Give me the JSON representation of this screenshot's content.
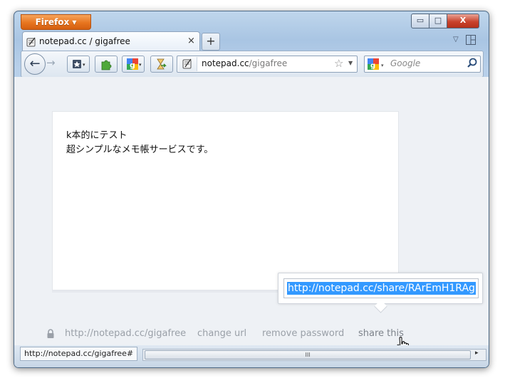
{
  "window": {
    "menu_button": "Firefox ▾",
    "min_glyph": "▭",
    "max_glyph": "□",
    "close_glyph": "X"
  },
  "tab": {
    "title": "notepad.cc / gigafree",
    "close_glyph": "×",
    "new_tab_glyph": "+"
  },
  "nav": {
    "back_glyph": "←",
    "forward_glyph": "→"
  },
  "urlbar": {
    "domain": "notepad.cc",
    "path": "/gigafree",
    "star_glyph": "☆",
    "dropdown_glyph": "▼"
  },
  "search": {
    "placeholder": "Google"
  },
  "note": {
    "lines": [
      "k本的にテスト",
      "超シンプルなメモ帳サービスです。"
    ]
  },
  "share": {
    "url": "http://notepad.cc/share/RArEmH1RAg"
  },
  "footer": {
    "page_url": "http://notepad.cc/gigafree",
    "change_url": "change url",
    "remove_password": "remove password",
    "share_this": "share this"
  },
  "status": {
    "link_url": "http://notepad.cc/gigafree#",
    "scroll_grip": "III",
    "scroll_right": "▸"
  },
  "colors": {
    "firefox_button": "#e8751f",
    "selection": "#3399ff",
    "footer_text": "#9aa0a8"
  }
}
